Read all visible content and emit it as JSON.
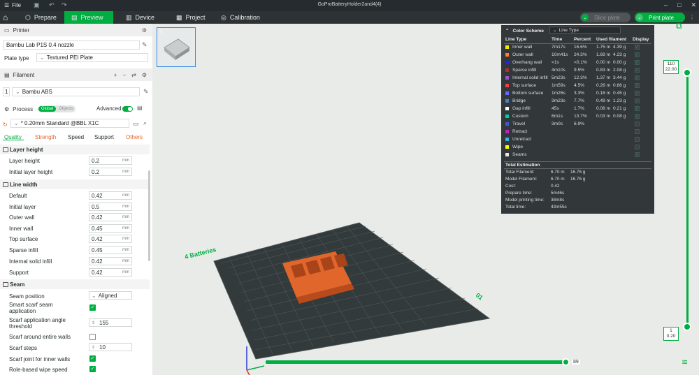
{
  "titlebar": {
    "menu_label": "File",
    "doc_title": "GoProBatteryHolder2and4(4)"
  },
  "nav": {
    "tabs": [
      {
        "label": "Prepare"
      },
      {
        "label": "Preview"
      },
      {
        "label": "Device"
      },
      {
        "label": "Project"
      },
      {
        "label": "Calibration"
      }
    ],
    "slice_label": "Slice plate",
    "print_label": "Print plate"
  },
  "printer": {
    "section_label": "Printer",
    "name": "Bambu Lab P1S 0.4 nozzle",
    "plate_type_label": "Plate type",
    "plate_type_value": "Textured PEI Plate"
  },
  "filament": {
    "section_label": "Filament",
    "slot": "1",
    "name": "Bambu ABS"
  },
  "process": {
    "section_label": "Process",
    "global_label": "Global",
    "objects_label": "Objects",
    "advanced_label": "Advanced",
    "preset": "* 0.20mm Standard @BBL X1C",
    "tabs": [
      "Quality",
      "Strength",
      "Speed",
      "Support",
      "Others"
    ]
  },
  "settings": {
    "layer_height_group": "Layer height",
    "layer_height_label": "Layer height",
    "layer_height_value": "0.2",
    "initial_layer_height_label": "Initial layer height",
    "initial_layer_height_value": "0.2",
    "line_width_group": "Line width",
    "line_widths": [
      {
        "label": "Default",
        "value": "0.42"
      },
      {
        "label": "Initial layer",
        "value": "0.5"
      },
      {
        "label": "Outer wall",
        "value": "0.42"
      },
      {
        "label": "Inner wall",
        "value": "0.45"
      },
      {
        "label": "Top surface",
        "value": "0.42"
      },
      {
        "label": "Sparse infill",
        "value": "0.45"
      },
      {
        "label": "Internal solid infill",
        "value": "0.42"
      },
      {
        "label": "Support",
        "value": "0.42"
      }
    ],
    "unit": "mm",
    "seam_group": "Seam",
    "seam_position_label": "Seam position",
    "seam_position_value": "Aligned",
    "smart_scarf_label": "Smart scarf seam application",
    "scarf_threshold_label": "Scarf application angle threshold",
    "scarf_threshold_value": "155",
    "scarf_entire_wall_label": "Scarf around entire walls",
    "scarf_steps_label": "Scarf steps",
    "scarf_steps_value": "10",
    "scarf_inner_label": "Scarf joint for inner walls",
    "role_wipe_label": "Role-based wipe speed"
  },
  "color_scheme": {
    "title": "Color Scheme",
    "selected": "Line Type",
    "headers": [
      "Line Type",
      "Time",
      "Percent",
      "Used filament",
      "Display"
    ],
    "rows": [
      {
        "name": "Inner wall",
        "color": "#ffe600",
        "time": "7m17s",
        "percent": "16.6%",
        "len": "1.75 m",
        "weight": "4.39 g",
        "display": true
      },
      {
        "name": "Outer wall",
        "color": "#ff7d38",
        "time": "10m41s",
        "percent": "24.3%",
        "len": "1.69 m",
        "weight": "4.23 g",
        "display": true
      },
      {
        "name": "Overhang wall",
        "color": "#1f1fff",
        "time": "<1s",
        "percent": "<0.1%",
        "len": "0.00 m",
        "weight": "0.00 g",
        "display": true
      },
      {
        "name": "Sparse infill",
        "color": "#b03029",
        "time": "4m10s",
        "percent": "9.5%",
        "len": "0.83 m",
        "weight": "2.08 g",
        "display": true
      },
      {
        "name": "Internal solid infill",
        "color": "#9654cc",
        "time": "5m23s",
        "percent": "12.3%",
        "len": "1.37 m",
        "weight": "3.44 g",
        "display": true
      },
      {
        "name": "Top surface",
        "color": "#f04040",
        "time": "1m59s",
        "percent": "4.5%",
        "len": "0.26 m",
        "weight": "0.66 g",
        "display": true
      },
      {
        "name": "Bottom surface",
        "color": "#6666ff",
        "time": "1m26s",
        "percent": "3.3%",
        "len": "0.18 m",
        "weight": "0.45 g",
        "display": true
      },
      {
        "name": "Bridge",
        "color": "#4d80ba",
        "time": "3m23s",
        "percent": "7.7%",
        "len": "0.49 m",
        "weight": "1.23 g",
        "display": true
      },
      {
        "name": "Gap infill",
        "color": "#ffffff",
        "time": "45s",
        "percent": "1.7%",
        "len": "0.08 m",
        "weight": "0.21 g",
        "display": true
      },
      {
        "name": "Custom",
        "color": "#00d1a4",
        "time": "6m1s",
        "percent": "13.7%",
        "len": "0.03 m",
        "weight": "0.08 g",
        "display": true
      },
      {
        "name": "Travel",
        "color": "#3a5ccc",
        "time": "3m0s",
        "percent": "6.9%",
        "len": "",
        "weight": "",
        "display": false
      },
      {
        "name": "Retract",
        "color": "#c71acc",
        "time": "",
        "percent": "",
        "len": "",
        "weight": "",
        "display": false
      },
      {
        "name": "Unretract",
        "color": "#3bb3e0",
        "time": "",
        "percent": "",
        "len": "",
        "weight": "",
        "display": false
      },
      {
        "name": "Wipe",
        "color": "#ffff00",
        "time": "",
        "percent": "",
        "len": "",
        "weight": "",
        "display": false
      },
      {
        "name": "Seams",
        "color": "#e6e6e6",
        "time": "",
        "percent": "",
        "len": "",
        "weight": "",
        "display": true
      }
    ],
    "total_title": "Total Estimation",
    "totals": [
      {
        "label": "Total Filament:",
        "v1": "6.70 m",
        "v2": "16.76 g"
      },
      {
        "label": "Model Filament:",
        "v1": "6.70 m",
        "v2": "16.76 g"
      },
      {
        "label": "Cost:",
        "v1": "0.42",
        "v2": ""
      },
      {
        "label": "Prepare time:",
        "v1": "5m46s",
        "v2": ""
      },
      {
        "label": "Model printing time:",
        "v1": "38m8s",
        "v2": ""
      },
      {
        "label": "Total time:",
        "v1": "43m55s",
        "v2": ""
      }
    ]
  },
  "plate": {
    "label": "4 Batteries",
    "plate_no": "01",
    "thumb_index": "1"
  },
  "layer_slider": {
    "top_layer": "110",
    "top_height": "22.00",
    "bottom_layer": "1",
    "bottom_height": "0.20"
  },
  "move_slider": {
    "value": "89"
  },
  "colors": {
    "accent": "#00ae42",
    "part": "#e0662b"
  }
}
